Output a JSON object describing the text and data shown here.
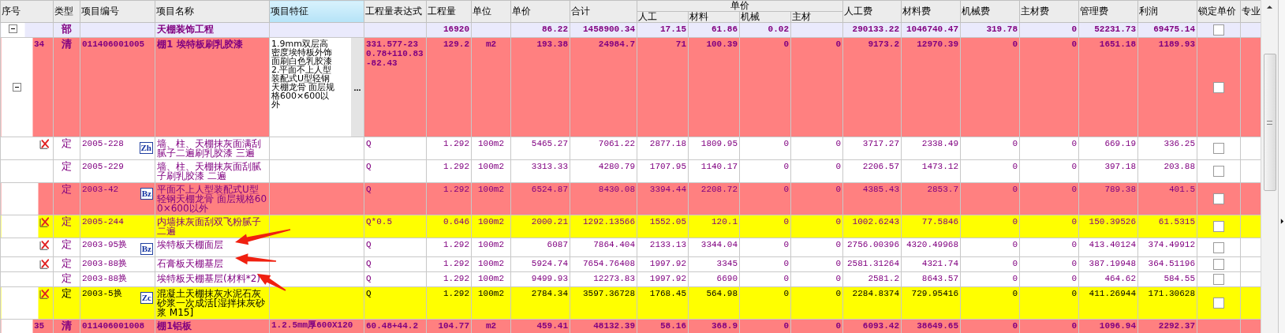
{
  "columns": [
    {
      "label": "序号",
      "selected": false
    },
    {
      "label": "类型",
      "selected": false
    },
    {
      "label": "项目编号",
      "selected": false
    },
    {
      "label": "项目名称",
      "selected": false
    },
    {
      "label": "项目特征",
      "selected": true
    },
    {
      "label": "工程量表达式",
      "selected": false
    },
    {
      "label": "工程量",
      "selected": false
    },
    {
      "label": "单位",
      "selected": false
    },
    {
      "label": "单价",
      "selected": false
    },
    {
      "label": "合计",
      "selected": false
    },
    {
      "label": "单价",
      "selected": false,
      "children": [
        {
          "label": "人工",
          "selected": false
        },
        {
          "label": "材料",
          "selected": false
        },
        {
          "label": "机械",
          "selected": false
        },
        {
          "label": "主材",
          "selected": false
        }
      ]
    },
    {
      "label": "人工费",
      "selected": false
    },
    {
      "label": "材料费",
      "selected": false
    },
    {
      "label": "机械费",
      "selected": false
    },
    {
      "label": "主材费",
      "selected": false
    },
    {
      "label": "管理费",
      "selected": false
    },
    {
      "label": "利润",
      "selected": false
    },
    {
      "label": "锁定单价",
      "selected": false
    },
    {
      "label": "专业",
      "selected": false
    }
  ],
  "rows": [
    {
      "kind": "section",
      "expanded": true,
      "color": "#eaeafc",
      "black_text": false,
      "type": "部",
      "name": "天棚装饰工程",
      "quantity": "16920",
      "unit_price": "86.22",
      "total": "1458900.34",
      "labor": "17.15",
      "material": "61.86",
      "machine": "0.02",
      "labor_fee": "290133.22",
      "material_fee": "1046740.47",
      "machine_fee": "319.78",
      "main_material_fee": "0",
      "management_fee": "52231.73",
      "profit": "69475.14",
      "locked": false
    },
    {
      "kind": "bill",
      "expanded": true,
      "color": "#ff8080",
      "black_text": false,
      "no": "34",
      "type": "清",
      "code": "011406001005",
      "name": "棚1 埃特板刷乳胶漆",
      "features": [
        "1.9mm双层高密度埃特板外饰面刷白色乳胶漆",
        "2.平面不上人型装配式U型轻钢天棚龙骨 面层规格600×600以外"
      ],
      "features_editing": true,
      "features_button": "...",
      "expression": "331.577-230.78+110.83-82.43",
      "quantity": "129.2",
      "unit": "m2",
      "unit_price": "193.38",
      "total": "24984.7",
      "labor": "71",
      "material": "100.39",
      "machine": "0",
      "main_material": "0",
      "labor_fee": "9173.2",
      "material_fee": "12970.39",
      "machine_fee": "0",
      "main_material_fee": "0",
      "management_fee": "1651.18",
      "profit": "1189.93",
      "locked": false
    },
    {
      "kind": "quota",
      "flagged": true,
      "badge": "Zh",
      "color": "#ffffff",
      "black_text": false,
      "type": "定",
      "code": "2005-228",
      "name": "墙、柱、天棚抹灰面满刮腻子二遍刷乳胶漆 三遍",
      "expression": "Q",
      "quantity": "1.292",
      "unit": "100m2",
      "unit_price": "5465.27",
      "total": "7061.22",
      "labor": "2877.18",
      "material": "1809.95",
      "machine": "0",
      "main_material": "0",
      "labor_fee": "3717.27",
      "material_fee": "2338.49",
      "machine_fee": "0",
      "main_material_fee": "0",
      "management_fee": "669.19",
      "profit": "336.25",
      "locked": false
    },
    {
      "kind": "quota",
      "flagged": false,
      "color": "#ffffff",
      "black_text": false,
      "type": "定",
      "code": "2005-229",
      "name": "墙、柱、天棚抹灰面刮腻子刷乳胶漆 二遍",
      "expression": "Q",
      "quantity": "1.292",
      "unit": "100m2",
      "unit_price": "3313.33",
      "total": "4280.79",
      "labor": "1707.95",
      "material": "1140.17",
      "machine": "0",
      "main_material": "0",
      "labor_fee": "2206.57",
      "material_fee": "1473.12",
      "machine_fee": "0",
      "main_material_fee": "0",
      "management_fee": "397.18",
      "profit": "203.88",
      "locked": false
    },
    {
      "kind": "quota",
      "flagged": false,
      "badge": "Bz",
      "color": "#ff8080",
      "black_text": false,
      "type": "定",
      "code": "2003-42",
      "name": "平面不上人型装配式U型轻钢天棚龙骨 面层规格600×600以外",
      "expression": "Q",
      "quantity": "1.292",
      "unit": "100m2",
      "unit_price": "6524.87",
      "total": "8430.08",
      "labor": "3394.44",
      "material": "2208.72",
      "machine": "0",
      "main_material": "0",
      "labor_fee": "4385.43",
      "material_fee": "2853.7",
      "machine_fee": "0",
      "main_material_fee": "0",
      "management_fee": "789.38",
      "profit": "401.5",
      "locked": false
    },
    {
      "kind": "quota",
      "flagged": true,
      "color": "#ffff00",
      "black_text": false,
      "type": "定",
      "code": "2005-244",
      "name": "内墙抹灰面刮双飞粉腻子二遍",
      "expression": "Q*0.5",
      "quantity": "0.646",
      "unit": "100m2",
      "unit_price": "2000.21",
      "total": "1292.13566",
      "labor": "1552.05",
      "material": "120.1",
      "machine": "0",
      "main_material": "0",
      "labor_fee": "1002.6243",
      "material_fee": "77.5846",
      "machine_fee": "0",
      "main_material_fee": "0",
      "management_fee": "150.39526",
      "profit": "61.5315",
      "locked": false
    },
    {
      "kind": "quota",
      "flagged": true,
      "badge": "Bz",
      "color": "#ffffff",
      "black_text": false,
      "type": "定",
      "code": "2003-95换",
      "name": "埃特板天棚面层",
      "expression": "Q",
      "quantity": "1.292",
      "unit": "100m2",
      "unit_price": "6087",
      "total": "7864.404",
      "labor": "2133.13",
      "material": "3344.04",
      "machine": "0",
      "main_material": "0",
      "labor_fee": "2756.00396",
      "material_fee": "4320.49968",
      "machine_fee": "0",
      "main_material_fee": "0",
      "management_fee": "413.40124",
      "profit": "374.49912",
      "locked": false
    },
    {
      "kind": "quota",
      "flagged": true,
      "color": "#ffffff",
      "black_text": false,
      "type": "定",
      "code": "2003-88换",
      "name": "石膏板天棚基层",
      "expression": "Q",
      "quantity": "1.292",
      "unit": "100m2",
      "unit_price": "5924.74",
      "total": "7654.76408",
      "labor": "1997.92",
      "material": "3345",
      "machine": "0",
      "main_material": "0",
      "labor_fee": "2581.31264",
      "material_fee": "4321.74",
      "machine_fee": "0",
      "main_material_fee": "0",
      "management_fee": "387.19948",
      "profit": "364.51196",
      "locked": false
    },
    {
      "kind": "quota",
      "flagged": false,
      "color": "#ffffff",
      "black_text": false,
      "type": "定",
      "code": "2003-88换",
      "name": "埃特板天棚基层(材料*2)",
      "expression": "Q",
      "quantity": "1.292",
      "unit": "100m2",
      "unit_price": "9499.93",
      "total": "12273.83",
      "labor": "1997.92",
      "material": "6690",
      "machine": "0",
      "main_material": "0",
      "labor_fee": "2581.2",
      "material_fee": "8643.57",
      "machine_fee": "0",
      "main_material_fee": "0",
      "management_fee": "464.62",
      "profit": "584.55",
      "locked": false
    },
    {
      "kind": "quota",
      "flagged": true,
      "badge": "Zc",
      "color": "#ffff00",
      "black_text": true,
      "type": "定",
      "code": "2003-5换",
      "name": "混凝土天棚抹灰水泥石灰砂浆一次成活[湿拌抹灰砂浆 M15]",
      "expression": "Q",
      "quantity": "1.292",
      "unit": "100m2",
      "unit_price": "2784.34",
      "total": "3597.36728",
      "labor": "1768.45",
      "material": "564.98",
      "machine": "0",
      "main_material": "0",
      "labor_fee": "2284.8374",
      "material_fee": "729.95416",
      "machine_fee": "0",
      "main_material_fee": "0",
      "management_fee": "411.26944",
      "profit": "171.30628",
      "locked": false
    },
    {
      "kind": "bill",
      "color": "#ff8080",
      "black_text": false,
      "no": "35",
      "type": "清",
      "code": "011406001008",
      "name": "棚1铝板",
      "features": [
        "1.2.5mm厚600X120"
      ],
      "features_editing": false,
      "expression": "60.48+44.2",
      "quantity": "104.77",
      "unit": "m2",
      "unit_price": "459.41",
      "total": "48132.39",
      "labor": "58.16",
      "material": "368.9",
      "machine": "0",
      "main_material": "0",
      "labor_fee": "6093.42",
      "material_fee": "38649.65",
      "machine_fee": "0",
      "main_material_fee": "0",
      "management_fee": "1096.94",
      "profit": "2292.37"
    }
  ]
}
